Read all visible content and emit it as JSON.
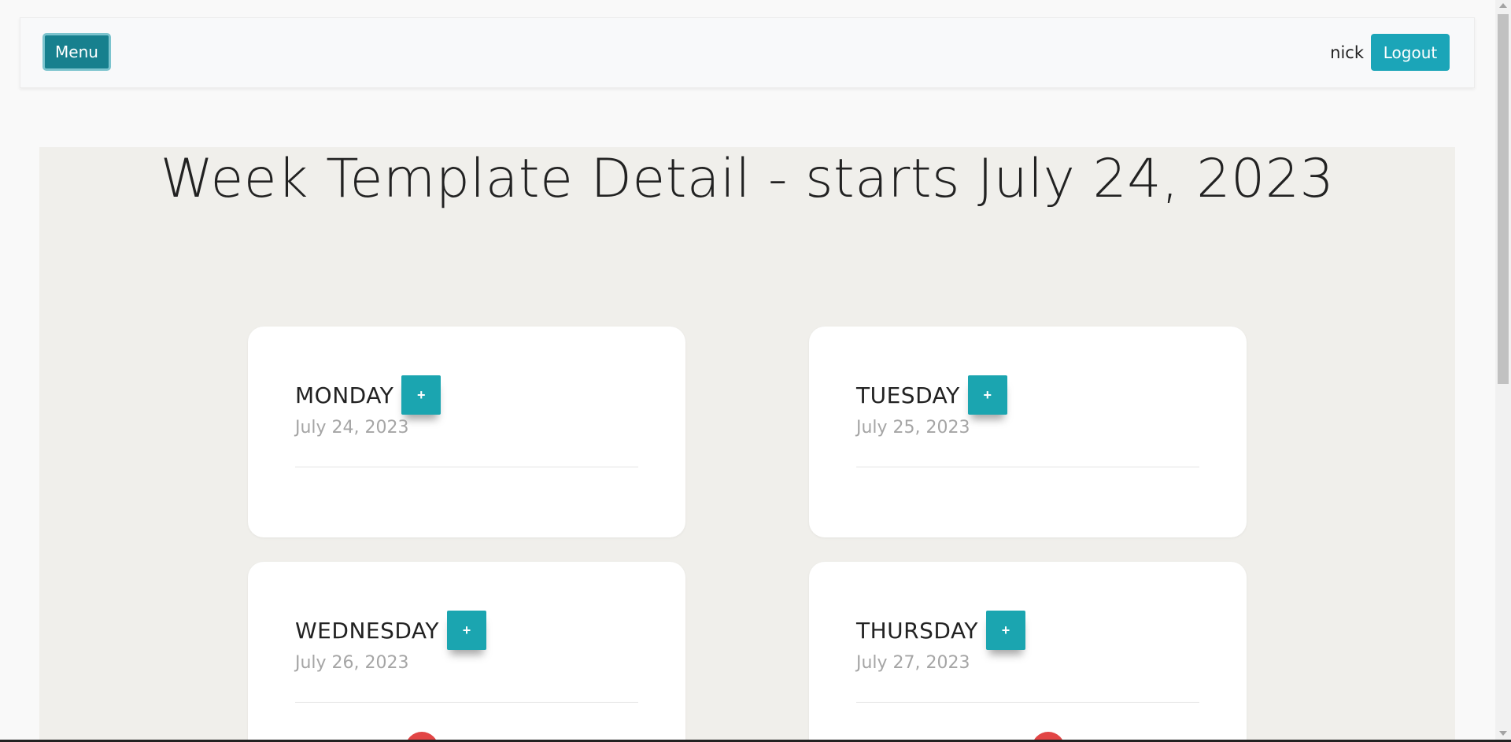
{
  "navbar": {
    "menu_label": "Menu",
    "username": "nick",
    "logout_label": "Logout"
  },
  "page": {
    "title": "Week Template Detail - starts July 24, 2023"
  },
  "days": [
    {
      "name": "MONDAY",
      "date": "July 24, 2023",
      "add_label": "+"
    },
    {
      "name": "TUESDAY",
      "date": "July 25, 2023",
      "add_label": "+"
    },
    {
      "name": "WEDNESDAY",
      "date": "July 26, 2023",
      "add_label": "+"
    },
    {
      "name": "THURSDAY",
      "date": "July 27, 2023",
      "add_label": "+"
    }
  ],
  "colors": {
    "primary": "#1ba5b8",
    "menu": "#17808e",
    "danger": "#e24545",
    "content_bg": "#f0efeb"
  }
}
